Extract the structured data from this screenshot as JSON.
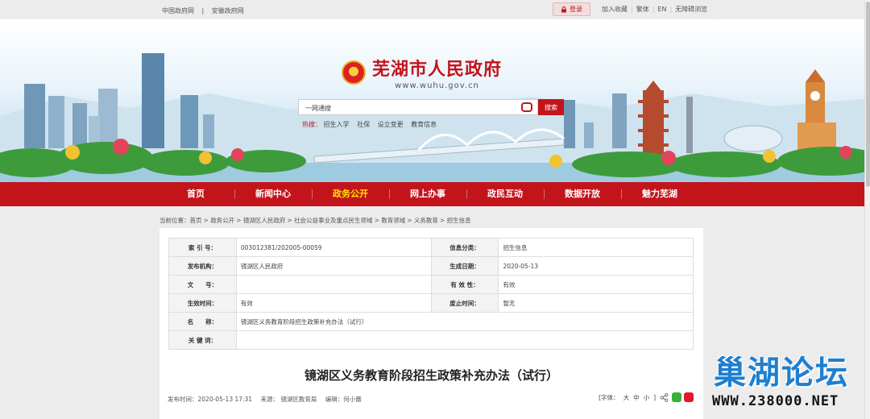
{
  "topbar": {
    "left_links": [
      "中国政府网",
      "安徽政府网"
    ],
    "login": "登录",
    "right_links": [
      "加入收藏",
      "繁体",
      "EN",
      "无障碍浏览"
    ]
  },
  "header": {
    "site_title": "芜湖市人民政府",
    "site_url": "www.wuhu.gov.cn"
  },
  "search": {
    "placeholder": "一网通搜",
    "button": "搜索",
    "hot_label": "热搜：",
    "hot_words": [
      "招生入学",
      "社保",
      "设立变更",
      "教育信息"
    ]
  },
  "nav": {
    "items": [
      "首页",
      "新闻中心",
      "政务公开",
      "网上办事",
      "政民互动",
      "数据开放",
      "魅力芜湖"
    ],
    "active_index": 2
  },
  "breadcrumb": {
    "items": [
      "当前位置：首页",
      "政务公开",
      "镜湖区人民政府",
      "社会公益事业及重点民生领域",
      "教育领域",
      "义务教育",
      "招生信息"
    ],
    "separator": ">"
  },
  "meta": {
    "rows": [
      [
        "索 引 号：",
        "003012381/202005-00059",
        "信息分类：",
        "招生信息"
      ],
      [
        "发布机构：",
        "镜湖区人民政府",
        "生成日期：",
        "2020-05-13"
      ],
      [
        "文　　号：",
        "",
        "有 效 性：",
        "有效"
      ],
      [
        "生效时间：",
        "有效",
        "废止时间：",
        "暂无"
      ]
    ],
    "name_label": "名　　称：",
    "name_value": "镜湖区义务教育阶段招生政策补充办法（试行）",
    "keyword_label": "关 键 词：",
    "keyword_value": ""
  },
  "article": {
    "title": "镜湖区义务教育阶段招生政策补充办法（试行）",
    "publish_time": "发布时间：2020-05-13 17:31",
    "source": "来源：  镜湖区教育局",
    "editor": "编辑：何小蕾",
    "font_label": "[字体：",
    "font_sizes": [
      "大",
      "中",
      "小"
    ],
    "font_end": "]"
  },
  "watermark": {
    "title": "巢湖论坛",
    "url": "WWW.238000.NET"
  }
}
